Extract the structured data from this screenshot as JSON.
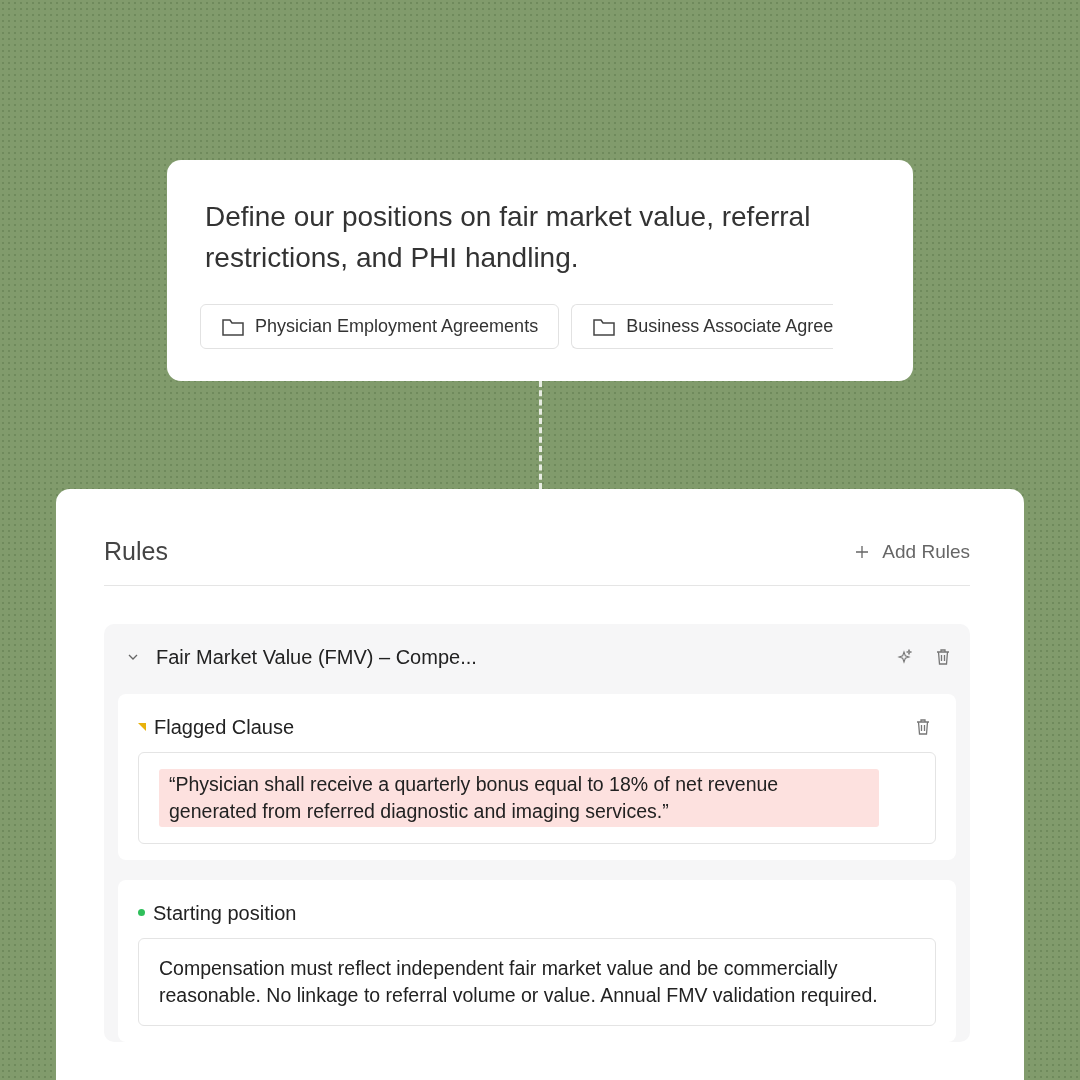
{
  "prompt": {
    "text": "Define our positions on fair market value, referral restrictions, and PHI handling.",
    "folders": [
      {
        "label": "Physician Employment Agreements"
      },
      {
        "label": "Business Associate Agree"
      }
    ]
  },
  "rules_panel": {
    "title": "Rules",
    "add_button": "Add Rules",
    "groups": [
      {
        "title": "Fair Market Value (FMV) – Compe...",
        "expanded": true,
        "sections": [
          {
            "kind": "flagged",
            "title": "Flagged Clause",
            "color": "#e8b20c",
            "text": "“Physician shall receive a quarterly bonus equal to 18% of net revenue generated from referred diagnostic and imaging services.”"
          },
          {
            "kind": "position",
            "title": "Starting position",
            "color": "#2fbf5b",
            "text": "Compensation must reflect independent fair market value and be commercially reasonable. No linkage to referral volume or value. Annual FMV validation required."
          }
        ]
      }
    ]
  }
}
